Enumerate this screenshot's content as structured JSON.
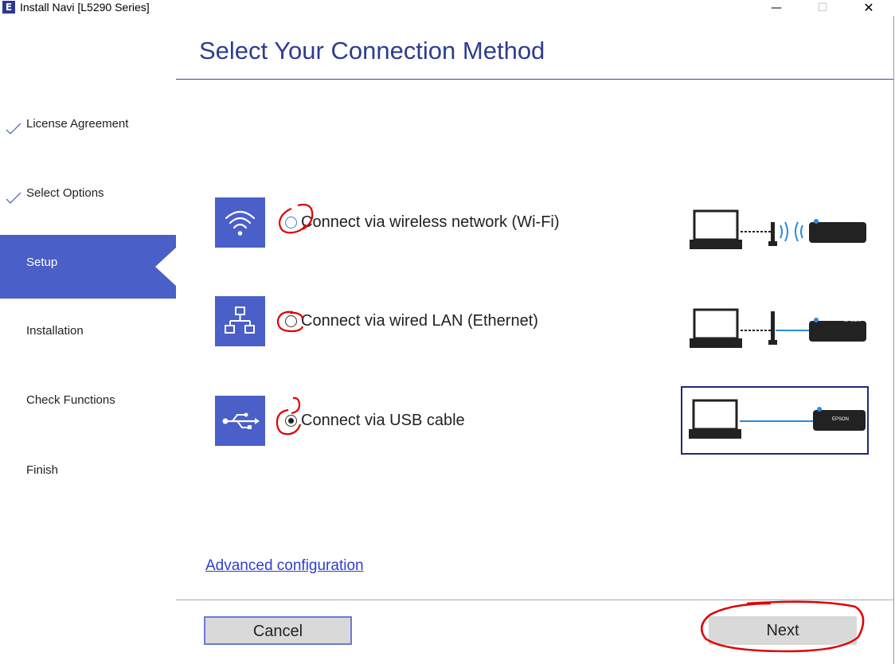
{
  "window": {
    "app_icon_letter": "E",
    "title": "Install Navi [L5290 Series]",
    "min_glyph": "—",
    "max_glyph": "☐",
    "close_glyph": "✕"
  },
  "header": {
    "title": "Select Your Connection Method"
  },
  "sidebar": {
    "items": [
      {
        "label": "License Agreement",
        "state": "done"
      },
      {
        "label": "Select Options",
        "state": "done"
      },
      {
        "label": "Setup",
        "state": "active"
      },
      {
        "label": "Installation",
        "state": "pending"
      },
      {
        "label": "Check Functions",
        "state": "pending"
      },
      {
        "label": "Finish",
        "state": "pending"
      }
    ]
  },
  "options": [
    {
      "label": "Connect via wireless network (Wi-Fi)",
      "icon": "wifi-icon",
      "selected": false
    },
    {
      "label": "Connect via wired LAN (Ethernet)",
      "icon": "network-icon",
      "selected": false
    },
    {
      "label": "Connect via USB cable",
      "icon": "usb-icon",
      "selected": true
    }
  ],
  "diagram": {
    "printer_brand": "EPSON"
  },
  "advanced_link": "Advanced configuration",
  "buttons": {
    "cancel": "Cancel",
    "next": "Next"
  },
  "colors": {
    "accent": "#4a5fc8",
    "title": "#2e3d8f",
    "link": "#2b3fd0",
    "annotation": "#e00000"
  }
}
